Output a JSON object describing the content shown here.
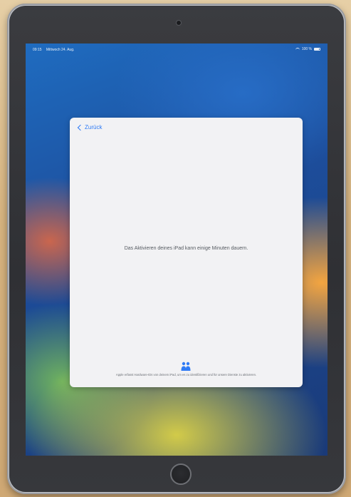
{
  "status_bar": {
    "time": "09:15",
    "date": "Mittwoch 24. Aug.",
    "battery": "100 %",
    "wifi_icon": "wifi-icon",
    "battery_icon": "battery-icon"
  },
  "setup": {
    "back_label": "Zurück",
    "back_icon": "chevron-left-icon",
    "message": "Das Aktivieren deines iPad kann einige Minuten dauern.",
    "privacy_icon": "privacy-handshake-icon",
    "privacy_text": "Apple erfasst Hardware-IDs von deinem iPad, um es zu identifizieren und für unsere Dienste zu aktivieren.",
    "privacy_accent": "#2f7bf5"
  }
}
